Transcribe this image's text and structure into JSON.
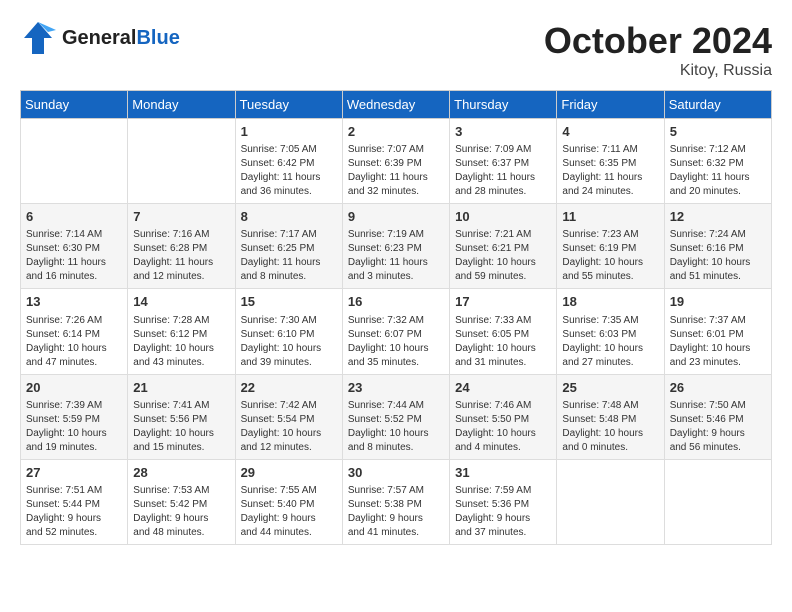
{
  "header": {
    "logo_general": "General",
    "logo_blue": "Blue",
    "month_year": "October 2024",
    "location": "Kitoy, Russia"
  },
  "days_of_week": [
    "Sunday",
    "Monday",
    "Tuesday",
    "Wednesday",
    "Thursday",
    "Friday",
    "Saturday"
  ],
  "weeks": [
    [
      {
        "day": "",
        "info": ""
      },
      {
        "day": "",
        "info": ""
      },
      {
        "day": "1",
        "info": "Sunrise: 7:05 AM\nSunset: 6:42 PM\nDaylight: 11 hours\nand 36 minutes."
      },
      {
        "day": "2",
        "info": "Sunrise: 7:07 AM\nSunset: 6:39 PM\nDaylight: 11 hours\nand 32 minutes."
      },
      {
        "day": "3",
        "info": "Sunrise: 7:09 AM\nSunset: 6:37 PM\nDaylight: 11 hours\nand 28 minutes."
      },
      {
        "day": "4",
        "info": "Sunrise: 7:11 AM\nSunset: 6:35 PM\nDaylight: 11 hours\nand 24 minutes."
      },
      {
        "day": "5",
        "info": "Sunrise: 7:12 AM\nSunset: 6:32 PM\nDaylight: 11 hours\nand 20 minutes."
      }
    ],
    [
      {
        "day": "6",
        "info": "Sunrise: 7:14 AM\nSunset: 6:30 PM\nDaylight: 11 hours\nand 16 minutes."
      },
      {
        "day": "7",
        "info": "Sunrise: 7:16 AM\nSunset: 6:28 PM\nDaylight: 11 hours\nand 12 minutes."
      },
      {
        "day": "8",
        "info": "Sunrise: 7:17 AM\nSunset: 6:25 PM\nDaylight: 11 hours\nand 8 minutes."
      },
      {
        "day": "9",
        "info": "Sunrise: 7:19 AM\nSunset: 6:23 PM\nDaylight: 11 hours\nand 3 minutes."
      },
      {
        "day": "10",
        "info": "Sunrise: 7:21 AM\nSunset: 6:21 PM\nDaylight: 10 hours\nand 59 minutes."
      },
      {
        "day": "11",
        "info": "Sunrise: 7:23 AM\nSunset: 6:19 PM\nDaylight: 10 hours\nand 55 minutes."
      },
      {
        "day": "12",
        "info": "Sunrise: 7:24 AM\nSunset: 6:16 PM\nDaylight: 10 hours\nand 51 minutes."
      }
    ],
    [
      {
        "day": "13",
        "info": "Sunrise: 7:26 AM\nSunset: 6:14 PM\nDaylight: 10 hours\nand 47 minutes."
      },
      {
        "day": "14",
        "info": "Sunrise: 7:28 AM\nSunset: 6:12 PM\nDaylight: 10 hours\nand 43 minutes."
      },
      {
        "day": "15",
        "info": "Sunrise: 7:30 AM\nSunset: 6:10 PM\nDaylight: 10 hours\nand 39 minutes."
      },
      {
        "day": "16",
        "info": "Sunrise: 7:32 AM\nSunset: 6:07 PM\nDaylight: 10 hours\nand 35 minutes."
      },
      {
        "day": "17",
        "info": "Sunrise: 7:33 AM\nSunset: 6:05 PM\nDaylight: 10 hours\nand 31 minutes."
      },
      {
        "day": "18",
        "info": "Sunrise: 7:35 AM\nSunset: 6:03 PM\nDaylight: 10 hours\nand 27 minutes."
      },
      {
        "day": "19",
        "info": "Sunrise: 7:37 AM\nSunset: 6:01 PM\nDaylight: 10 hours\nand 23 minutes."
      }
    ],
    [
      {
        "day": "20",
        "info": "Sunrise: 7:39 AM\nSunset: 5:59 PM\nDaylight: 10 hours\nand 19 minutes."
      },
      {
        "day": "21",
        "info": "Sunrise: 7:41 AM\nSunset: 5:56 PM\nDaylight: 10 hours\nand 15 minutes."
      },
      {
        "day": "22",
        "info": "Sunrise: 7:42 AM\nSunset: 5:54 PM\nDaylight: 10 hours\nand 12 minutes."
      },
      {
        "day": "23",
        "info": "Sunrise: 7:44 AM\nSunset: 5:52 PM\nDaylight: 10 hours\nand 8 minutes."
      },
      {
        "day": "24",
        "info": "Sunrise: 7:46 AM\nSunset: 5:50 PM\nDaylight: 10 hours\nand 4 minutes."
      },
      {
        "day": "25",
        "info": "Sunrise: 7:48 AM\nSunset: 5:48 PM\nDaylight: 10 hours\nand 0 minutes."
      },
      {
        "day": "26",
        "info": "Sunrise: 7:50 AM\nSunset: 5:46 PM\nDaylight: 9 hours\nand 56 minutes."
      }
    ],
    [
      {
        "day": "27",
        "info": "Sunrise: 7:51 AM\nSunset: 5:44 PM\nDaylight: 9 hours\nand 52 minutes."
      },
      {
        "day": "28",
        "info": "Sunrise: 7:53 AM\nSunset: 5:42 PM\nDaylight: 9 hours\nand 48 minutes."
      },
      {
        "day": "29",
        "info": "Sunrise: 7:55 AM\nSunset: 5:40 PM\nDaylight: 9 hours\nand 44 minutes."
      },
      {
        "day": "30",
        "info": "Sunrise: 7:57 AM\nSunset: 5:38 PM\nDaylight: 9 hours\nand 41 minutes."
      },
      {
        "day": "31",
        "info": "Sunrise: 7:59 AM\nSunset: 5:36 PM\nDaylight: 9 hours\nand 37 minutes."
      },
      {
        "day": "",
        "info": ""
      },
      {
        "day": "",
        "info": ""
      }
    ]
  ]
}
